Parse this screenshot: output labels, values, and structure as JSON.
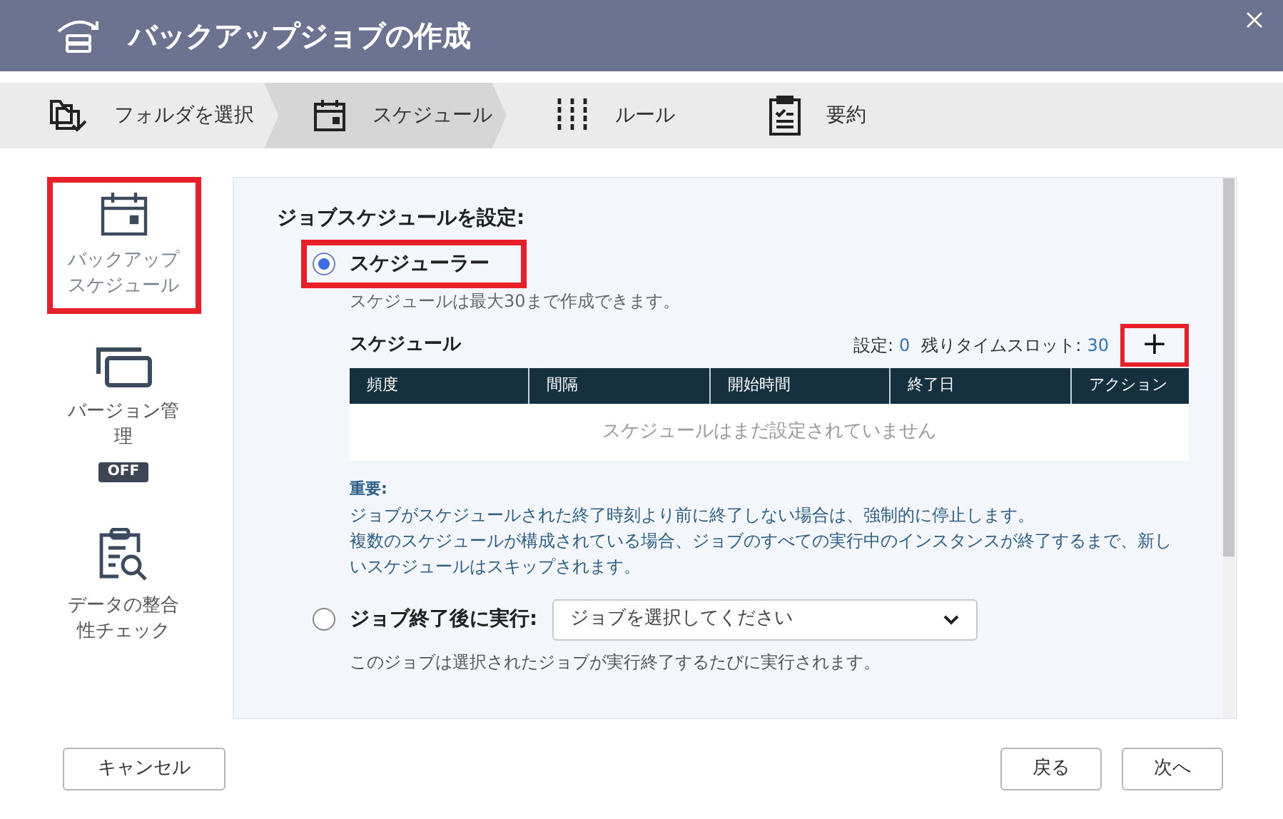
{
  "window": {
    "title": "バックアップジョブの作成"
  },
  "steps": [
    {
      "label": "フォルダを選択",
      "selected": false
    },
    {
      "label": "スケジュール",
      "selected": true
    },
    {
      "label": "ルール",
      "selected": false
    },
    {
      "label": "要約",
      "selected": false
    }
  ],
  "sidebar": {
    "items": [
      {
        "label": "バックアップスケジュール",
        "selected": true,
        "highlighted": true
      },
      {
        "label": "バージョン管理",
        "selected": false,
        "highlighted": false,
        "badge": "OFF"
      },
      {
        "label": "データの整合性チェック",
        "selected": false,
        "highlighted": false
      }
    ]
  },
  "panel": {
    "heading": "ジョブスケジュールを設定:",
    "scheduler": {
      "label": "スケジューラー",
      "selected": true,
      "highlighted": true,
      "hint": "スケジュールは最大30まで作成できます。",
      "table_title": "スケジュール",
      "set_label": "設定:",
      "set_value": "0",
      "remaining_label": "残りタイムスロット:",
      "remaining_value": "30",
      "add_button": {
        "label": "+",
        "highlighted": true
      },
      "columns": [
        "頻度",
        "間隔",
        "開始時間",
        "終了日",
        "アクション"
      ],
      "empty_message": "スケジュールはまだ設定されていません",
      "important_label": "重要:",
      "important_lines": [
        "ジョブがスケジュールされた終了時刻より前に終了しない場合は、強制的に停止します。",
        "複数のスケジュールが構成されている場合、ジョブのすべての実行中のインスタンスが終了するまで、新しいスケジュールはスキップされます。"
      ]
    },
    "after_job": {
      "label": "ジョブ終了後に実行:",
      "selected": false,
      "placeholder": "ジョブを選択してください",
      "hint": "このジョブは選択されたジョブが実行終了するたびに実行されます。"
    }
  },
  "footer": {
    "cancel": "キャンセル",
    "back": "戻る",
    "next": "次へ"
  }
}
